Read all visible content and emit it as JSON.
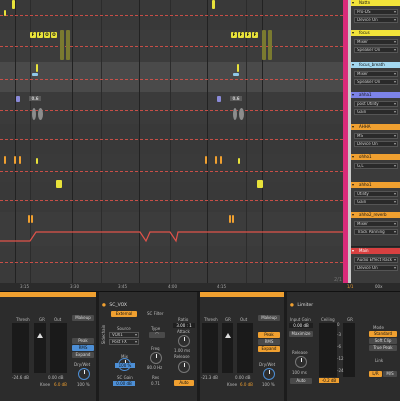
{
  "arrangement": {
    "ruler_ticks": [
      "3:15",
      "3:30",
      "3:45",
      "4:00",
      "4:15"
    ],
    "ruler_marker": "2/1",
    "clip_labels": [
      "F",
      "F",
      "O",
      "O",
      "F",
      "F",
      "F",
      "F"
    ],
    "auto_labels": [
      "0.6",
      "0.6"
    ]
  },
  "tracks": [
    {
      "name": "Nattn",
      "color": "#f2e33a",
      "fields": [
        "Pro-DS",
        "Device On"
      ]
    },
    {
      "name": "focus",
      "color": "#f2e33a",
      "fields": [
        "Mixer",
        "Speaker On"
      ]
    },
    {
      "name": "focus_breath",
      "color": "#a4d8f0",
      "fields": [
        "Mixer",
        "Speaker On"
      ]
    },
    {
      "name": "ahha1",
      "color": "#7c83e8",
      "fields": [
        "post Utility",
        "Gain"
      ]
    },
    {
      "name": "AHHA",
      "color": "#f0a030",
      "fields": [
        "MS",
        "Device On"
      ]
    },
    {
      "name": "ohho1",
      "color": "#f0a030",
      "fields": [
        "G,L"
      ]
    },
    {
      "name": "ahho1",
      "color": "#f0a030",
      "fields": [
        "Utility",
        "Gain"
      ]
    },
    {
      "name": "ahho2_reverb",
      "color": "#f0a030",
      "fields": [
        "Mixer",
        "Track Panning"
      ]
    },
    {
      "name": "Main",
      "color": "#d84040",
      "fields": [
        "Audio Effect Rack",
        "Device On"
      ]
    }
  ],
  "bottom_bar": {
    "zoom": "1/1",
    "value": "00x"
  },
  "devices": {
    "comp1": {
      "labels": [
        "Thresh",
        "GR",
        "Out"
      ],
      "readouts": [
        "-24.6 dB",
        "0.00 dB",
        "Knee",
        "6.0 dB"
      ],
      "buttons": [
        "Makeup",
        "Peak",
        "RMS",
        "Expand"
      ],
      "drywet_label": "Dry/Wet",
      "drywet_value": "100 %"
    },
    "sc_vox": {
      "title": "SC_VOX",
      "sections": [
        "Sidechain",
        "SC Filter"
      ],
      "ext_button": "External",
      "source_label": "Source",
      "source_value": "VOX1",
      "pos_value": "Post FX",
      "type_label": "Type",
      "freq_label": "Freq",
      "freq_value": "80.0 Hz",
      "mix_label": "Mix",
      "mix_value": "100 %",
      "gain_label": "SC Gain",
      "gain_value": "0.00 dB",
      "res_label": "Res",
      "res_value": "0.71"
    },
    "comp2": {
      "ratio_label": "Ratio",
      "ratio_value": "3.00 : 1",
      "attack_label": "Attack",
      "attack_value": "1.00 ms",
      "release_label": "Release",
      "release_value": "Auto",
      "labels": [
        "Thresh",
        "GR",
        "Out"
      ],
      "readouts": [
        "-21.3 dB",
        "0.00 dB",
        "Knee",
        "6.0 dB"
      ],
      "buttons": [
        "Makeup",
        "Peak",
        "RMS",
        "Expand"
      ],
      "drywet_label": "Dry/Wet",
      "drywet_value": "100 %"
    },
    "limiter": {
      "title": "Limiter",
      "input_label": "Input Gain",
      "input_value": "0.00 dB",
      "maximize": "Maximize",
      "release_label": "Release",
      "release_value": "100 ms",
      "auto": "Auto",
      "ceiling_label": "Ceiling",
      "gr_label": "GR",
      "ceiling_value": "-0.2 dB",
      "scale": [
        "0",
        "-3",
        "-6",
        "-12",
        "-24"
      ],
      "mode_label": "Mode",
      "mode_value": "Standard",
      "soft_clip": "Soft Clip",
      "true_peak": "True Peak",
      "link": "Link",
      "side_values": [
        "L/R",
        "M/S"
      ]
    }
  }
}
